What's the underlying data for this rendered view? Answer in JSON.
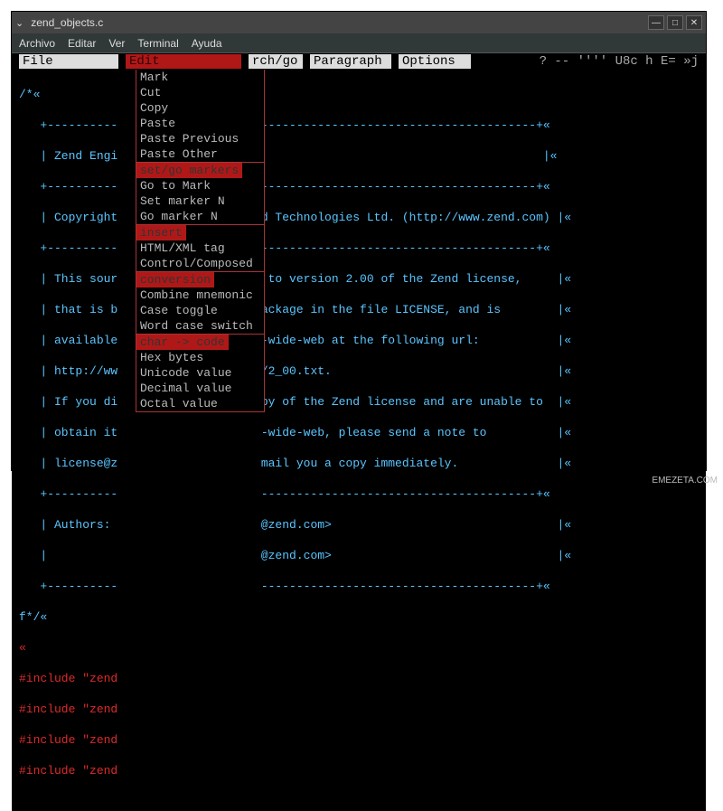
{
  "window": {
    "title": "zend_objects.c",
    "controls": {
      "min": "—",
      "max": "□",
      "close": "✕"
    }
  },
  "menubar": {
    "archivo": "Archivo",
    "editar": "Editar",
    "ver": "Ver",
    "terminal": "Terminal",
    "ayuda": "Ayuda"
  },
  "topbar": {
    "file": "File",
    "edit": "Edit",
    "search": "rch/go",
    "paragraph": "Paragraph",
    "options": "Options",
    "status": "?  -- '''' U8c h  E= »j"
  },
  "source": {
    "l0": "/*«",
    "l1a": "   +---------- ",
    "l1b": " ---------------------------------------+«",
    "l2a": "   | Zend Engi ",
    "l2b": "                                         |«",
    "l3a": "   +---------- ",
    "l3b": " ---------------------------------------+«",
    "l4a": "   | Copyright ",
    "l4b": " d Technologies Ltd. (http://www.zend.com) |«",
    "l5a": "   +---------- ",
    "l5b": " ---------------------------------------+«",
    "l6a": "   | This sour ",
    "l6b": "  to version 2.00 of the Zend license,     |«",
    "l7a": "   | that is b ",
    "l7b": " ackage in the file LICENSE, and is        |«",
    "l8a": "   | available ",
    "l8b": " -wide-web at the following url:           |«",
    "l9a": "   | http://ww ",
    "l9b": " /2_00.txt.                                |«",
    "l10a": "   | If you di ",
    "l10b": " py of the Zend license and are unable to  |«",
    "l11a": "   | obtain it ",
    "l11b": " -wide-web, please send a note to          |«",
    "l12a": "   | license@z ",
    "l12b": " mail you a copy immediately.              |«",
    "l13a": "   +---------- ",
    "l13b": " ---------------------------------------+«",
    "l14a": "   | Authors:  ",
    "l14b": " @zend.com>                                |«",
    "l15a": "   |           ",
    "l15b": " @zend.com>                                |«",
    "l16a": "   +---------- ",
    "l16b": " ---------------------------------------+«",
    "l17": "f*/«",
    "l18": "«",
    "l19": "#include \"zend",
    "l20": "#include \"zend",
    "l21": "#include \"zend",
    "l22": "#include \"zend"
  },
  "dropdown": {
    "h_edit": "Edit",
    "mark": "Mark",
    "cut": "Cut",
    "copy": "Copy",
    "paste": "Paste",
    "paste_prev": "Paste Previous",
    "paste_other": "Paste Other",
    "h_setgo": "set/go markers",
    "goto_mark": "Go to Mark",
    "set_marker": "Set marker N",
    "go_marker": "Go marker N",
    "h_insert": "insert",
    "html_xml": "HTML/XML tag",
    "control_comp": "Control/Composed",
    "h_conv": "conversion",
    "combine": "Combine mnemonic",
    "case_tog": "Case toggle",
    "word_case": "Word case switch",
    "h_char": "char -> code",
    "hex": "Hex bytes",
    "unicode": "Unicode value",
    "decimal": "Decimal value",
    "octal": "Octal value"
  },
  "watermark": "EMEZETA.COM"
}
